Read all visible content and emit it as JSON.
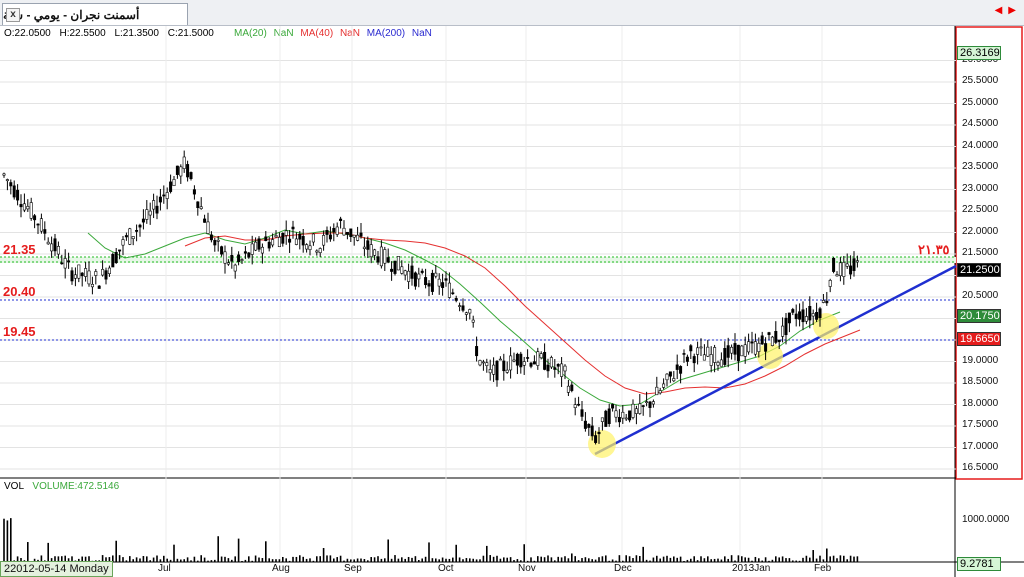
{
  "tab": {
    "title": "أسمنت نجران - يومي - سنة",
    "close_glyph": "x"
  },
  "scroll_arrows": {
    "left": "◀",
    "right": "▶"
  },
  "ohlc": {
    "open": "O:22.0500",
    "high": "H:22.5500",
    "low": "L:21.3500",
    "close": "C:21.5000"
  },
  "ma_legend": [
    {
      "label": "MA(20)",
      "value": "NaN",
      "color": "#3aa83a"
    },
    {
      "label": "MA(40)",
      "value": "NaN",
      "color": "#e53030"
    },
    {
      "label": "MA(200)",
      "value": "NaN",
      "color": "#2a2ad0"
    }
  ],
  "colors": {
    "border_red": "#e51c1c",
    "ma20": "#3aa83a",
    "ma40": "#e53030",
    "trend": "#1f2fd0",
    "dotted_level": "#1f2fd0",
    "green_level": "#22bb22",
    "highlight": "#fff266"
  },
  "levels": {
    "upper_left": "21.35",
    "upper_right": "٢١.٣٥",
    "mid": "20.40",
    "low": "19.45"
  },
  "price_tags": [
    {
      "text": "26.3169",
      "bg": "#d6f5d6"
    },
    {
      "text": "21.2500",
      "bg": "#000000"
    },
    {
      "text": "20.1750",
      "bg": "#2e8b3a"
    },
    {
      "text": "19.6650",
      "bg": "#e51c1c"
    }
  ],
  "chart_data": {
    "type": "candlestick",
    "y_ticks": [
      "26.0000",
      "25.5000",
      "25.0000",
      "24.5000",
      "24.0000",
      "23.5000",
      "23.0000",
      "22.5000",
      "22.0000",
      "21.5000",
      "21.0000",
      "20.5000",
      "20.0000",
      "19.5000",
      "19.0000",
      "18.5000",
      "18.0000",
      "17.5000",
      "17.0000",
      "16.5000"
    ],
    "ylim": [
      16.3,
      26.3
    ],
    "x_labels": [
      "Jul",
      "Aug",
      "Sep",
      "Oct",
      "Nov",
      "Dec",
      "2013Jan",
      "Feb"
    ],
    "volume_tick": "1000.0000",
    "volume_readout": "9.2781",
    "volume_legend": {
      "label": "VOL",
      "value": "VOLUME:472.5146"
    },
    "date_readout": "2012-05-14 Monday",
    "date_prefix": "2"
  }
}
